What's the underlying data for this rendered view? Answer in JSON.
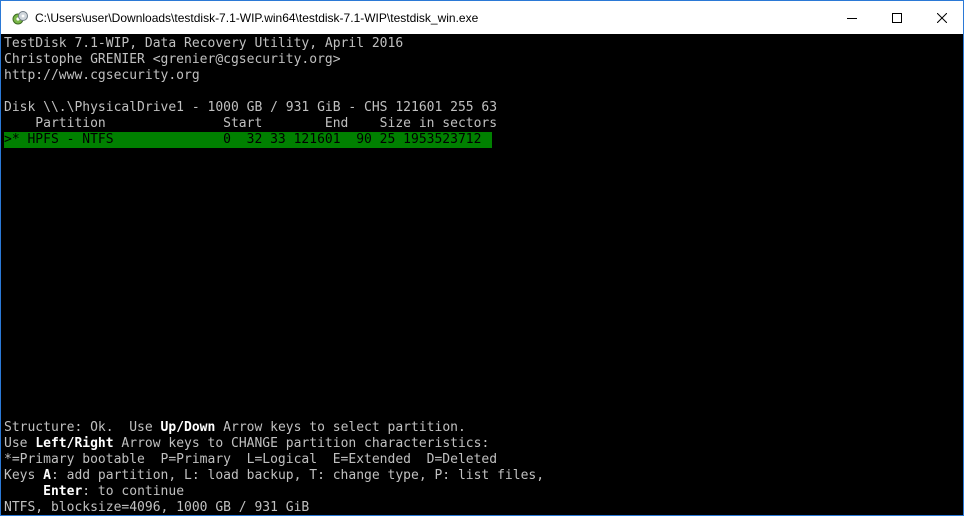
{
  "window": {
    "title": "C:\\Users\\user\\Downloads\\testdisk-7.1-WIP.win64\\testdisk-7.1-WIP\\testdisk_win.exe",
    "icon": "testdisk-app-icon",
    "controls": [
      "minimize-icon",
      "maximize-icon",
      "close-icon"
    ]
  },
  "header": {
    "line1": "TestDisk 7.1-WIP, Data Recovery Utility, April 2016",
    "line2": "Christophe GRENIER <grenier@cgsecurity.org>",
    "line3": "http://www.cgsecurity.org"
  },
  "disk": {
    "info": "Disk \\\\.\\PhysicalDrive1 - 1000 GB / 931 GiB - CHS 121601 255 63",
    "columns": "    Partition               Start        End    Size in sectors"
  },
  "partitions": [
    {
      "row": ">* HPFS - NTFS              0  32 33 121601  90 25 1953523712"
    }
  ],
  "footer": {
    "line1_a": "Structure: Ok.  Use ",
    "line1_key": "Up/Down",
    "line1_b": " Arrow keys to select partition.",
    "line2_a": "Use ",
    "line2_key": "Left/Right",
    "line2_b": " Arrow keys to CHANGE partition characteristics:",
    "line3": "*=Primary bootable  P=Primary  L=Logical  E=Extended  D=Deleted",
    "line4_a": "Keys ",
    "line4_key": "A",
    "line4_b": ": add partition, L: load backup, T: change type, P: list files,",
    "line5_indent": "     ",
    "line5_key": "Enter",
    "line5_b": ": to continue",
    "line6": "NTFS, blocksize=4096, 1000 GB / 931 GiB"
  },
  "colors": {
    "selection_bg": "#008000",
    "console_text": "#c0c0c0",
    "console_bg": "#000000",
    "highlight_text": "#ffffff",
    "window_border": "#2b79d6"
  }
}
